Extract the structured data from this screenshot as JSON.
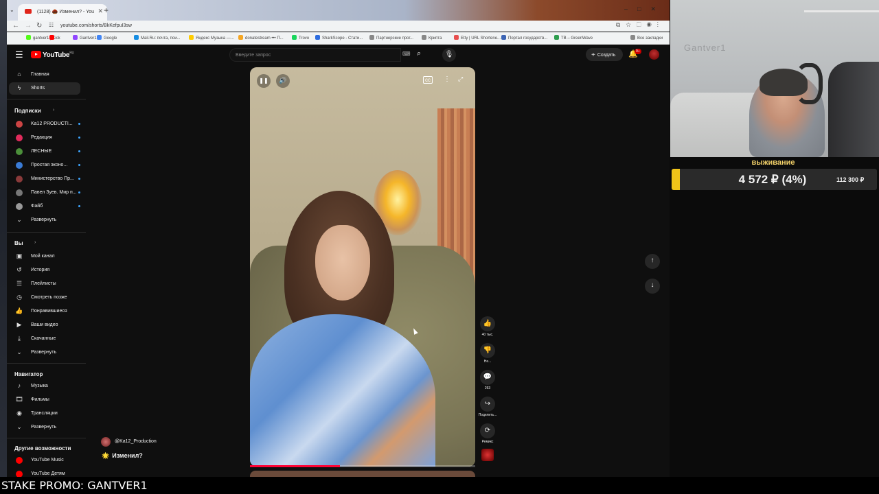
{
  "browser": {
    "tab_title": "(1128) 🌰 Изменил? - You",
    "url": "youtube.com/shorts/BkKefpuI3sw",
    "bookmarks": [
      {
        "label": "gantver1 | Kick",
        "color": "#53fc18"
      },
      {
        "label": "",
        "color": "#ff0000"
      },
      {
        "label": "Gantver1",
        "color": "#9146ff"
      },
      {
        "label": "Google",
        "color": "#4285f4"
      },
      {
        "label": "Mail.Ru: почта, пои...",
        "color": "#168de2"
      },
      {
        "label": "Яндекс Музыка —...",
        "color": "#ffcc00"
      },
      {
        "label": "donatestream ••• П...",
        "color": "#f5a623"
      },
      {
        "label": "Trovo",
        "color": "#19d65c"
      },
      {
        "label": "SharkScope - Стати...",
        "color": "#2d6cdf"
      },
      {
        "label": "Партнерские прог...",
        "color": "#888888"
      },
      {
        "label": "Крипта",
        "color": "#888888"
      },
      {
        "label": "Etty | URL Shortene...",
        "color": "#e84f4f"
      },
      {
        "label": "Портал государств...",
        "color": "#3c64b4"
      },
      {
        "label": "TB – GreenWave",
        "color": "#2e9e4f"
      },
      {
        "label": "Все закладки",
        "color": "#888888"
      }
    ]
  },
  "youtube": {
    "logo": "YouTube",
    "logo_region": "RU",
    "search_placeholder": "Введите запрос",
    "create_label": "Создать",
    "notif_badge": "9+",
    "sidebar": {
      "top": [
        {
          "label": "Главная",
          "icon": "⌂"
        },
        {
          "label": "Shorts",
          "icon": "ϟ"
        }
      ],
      "subs_header": "Подписки",
      "subs": [
        {
          "label": "Ka12 PRODUCTI...",
          "color": "#c44"
        },
        {
          "label": "Редакция",
          "color": "#e02b5b"
        },
        {
          "label": "ЛЕСНЫЕ",
          "color": "#4b8f3a"
        },
        {
          "label": "Простая эконо...",
          "color": "#3a7bd5"
        },
        {
          "label": "Министерство Пр...",
          "color": "#8a3a3a"
        },
        {
          "label": "Павел Зуев. Мир п...",
          "color": "#777"
        },
        {
          "label": "Файб",
          "color": "#999"
        }
      ],
      "subs_expand": "Развернуть",
      "you_header": "Вы",
      "you_items": [
        {
          "label": "Мой канал",
          "icon": "▣"
        },
        {
          "label": "История",
          "icon": "↺"
        },
        {
          "label": "Плейлисты",
          "icon": "☰"
        },
        {
          "label": "Смотреть позже",
          "icon": "◷"
        },
        {
          "label": "Понравившиеся",
          "icon": "👍"
        },
        {
          "label": "Ваши видео",
          "icon": "▶"
        },
        {
          "label": "Скачанные",
          "icon": "⤓"
        },
        {
          "label": "Развернуть",
          "icon": "⌄"
        }
      ],
      "nav_header": "Навигатор",
      "nav_items": [
        {
          "label": "Музыка",
          "icon": "♪"
        },
        {
          "label": "Фильмы",
          "icon": "🎞"
        },
        {
          "label": "Трансляции",
          "icon": "◉"
        },
        {
          "label": "Развернуть",
          "icon": "⌄"
        }
      ],
      "other_header": "Другие возможности",
      "other_items": [
        {
          "label": "YouTube Music",
          "color": "#ff0000"
        },
        {
          "label": "YouTube Детям",
          "color": "#ff0000"
        }
      ]
    },
    "short": {
      "channel": "@Ka12_Production",
      "title": "Изменил?",
      "title_emoji": "🌟",
      "progress": 0.4,
      "actions": [
        {
          "icon": "👍",
          "label": "40 тыс."
        },
        {
          "icon": "👎",
          "label": "Не..."
        },
        {
          "icon": "💬",
          "label": "263"
        },
        {
          "icon": "↪",
          "label": "Поделить..."
        },
        {
          "icon": "⟳",
          "label": "Ремикс"
        }
      ]
    }
  },
  "stream_overlay": {
    "goal_label": "выживание",
    "goal_current": "4 572 ₽ (4%)",
    "goal_target": "112 300 ₽",
    "goal_fraction": 0.04,
    "webcam_wall_text": "Gantver1",
    "promo": "STAKE PROMO: GANTVER1"
  }
}
